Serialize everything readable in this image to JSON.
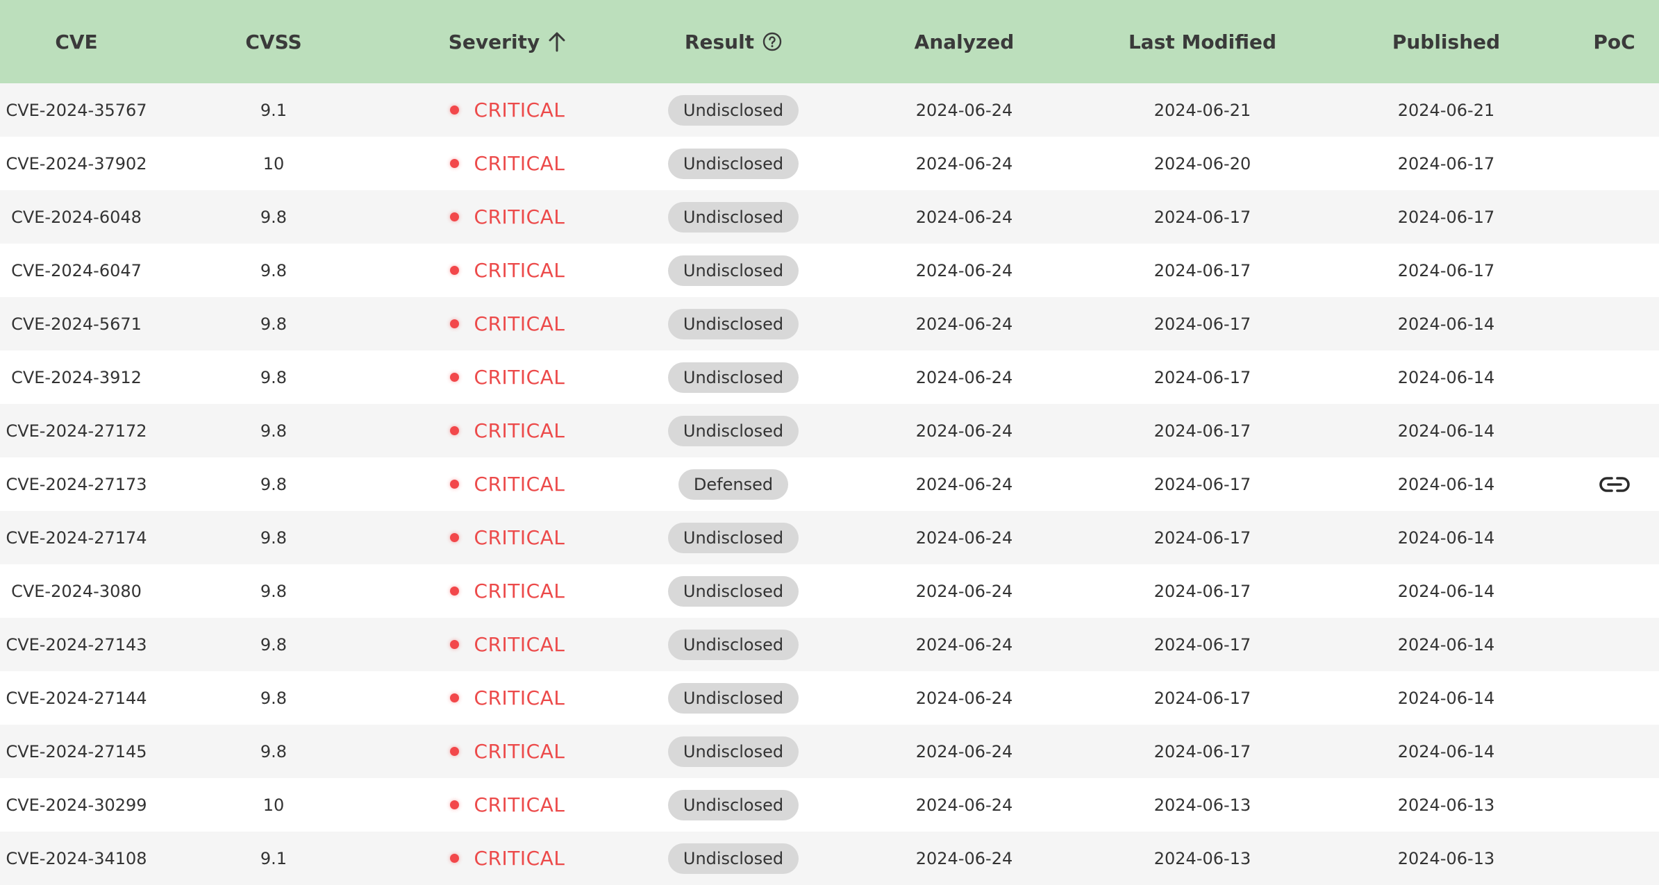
{
  "header": {
    "cve": "CVE",
    "cvss": "CVSS",
    "severity": "Severity",
    "result": "Result",
    "analyzed": "Analyzed",
    "last_modified": "Last Modified",
    "published": "Published",
    "poc": "PoC"
  },
  "colors": {
    "header_bg": "#bcdfbc",
    "critical": "#ec4a4a",
    "row_alt": "#f5f5f5",
    "pill_bg": "#d8d8d8"
  },
  "icons": {
    "sort": "arrow-up-icon",
    "help": "question-circle-icon",
    "poc": "link-icon"
  },
  "rows": [
    {
      "cve": "CVE-2024-35767",
      "cvss": "9.1",
      "severity": "CRITICAL",
      "result": "Undisclosed",
      "analyzed": "2024-06-24",
      "last_modified": "2024-06-21",
      "published": "2024-06-21",
      "poc": false
    },
    {
      "cve": "CVE-2024-37902",
      "cvss": "10",
      "severity": "CRITICAL",
      "result": "Undisclosed",
      "analyzed": "2024-06-24",
      "last_modified": "2024-06-20",
      "published": "2024-06-17",
      "poc": false
    },
    {
      "cve": "CVE-2024-6048",
      "cvss": "9.8",
      "severity": "CRITICAL",
      "result": "Undisclosed",
      "analyzed": "2024-06-24",
      "last_modified": "2024-06-17",
      "published": "2024-06-17",
      "poc": false
    },
    {
      "cve": "CVE-2024-6047",
      "cvss": "9.8",
      "severity": "CRITICAL",
      "result": "Undisclosed",
      "analyzed": "2024-06-24",
      "last_modified": "2024-06-17",
      "published": "2024-06-17",
      "poc": false
    },
    {
      "cve": "CVE-2024-5671",
      "cvss": "9.8",
      "severity": "CRITICAL",
      "result": "Undisclosed",
      "analyzed": "2024-06-24",
      "last_modified": "2024-06-17",
      "published": "2024-06-14",
      "poc": false
    },
    {
      "cve": "CVE-2024-3912",
      "cvss": "9.8",
      "severity": "CRITICAL",
      "result": "Undisclosed",
      "analyzed": "2024-06-24",
      "last_modified": "2024-06-17",
      "published": "2024-06-14",
      "poc": false
    },
    {
      "cve": "CVE-2024-27172",
      "cvss": "9.8",
      "severity": "CRITICAL",
      "result": "Undisclosed",
      "analyzed": "2024-06-24",
      "last_modified": "2024-06-17",
      "published": "2024-06-14",
      "poc": false
    },
    {
      "cve": "CVE-2024-27173",
      "cvss": "9.8",
      "severity": "CRITICAL",
      "result": "Defensed",
      "analyzed": "2024-06-24",
      "last_modified": "2024-06-17",
      "published": "2024-06-14",
      "poc": true
    },
    {
      "cve": "CVE-2024-27174",
      "cvss": "9.8",
      "severity": "CRITICAL",
      "result": "Undisclosed",
      "analyzed": "2024-06-24",
      "last_modified": "2024-06-17",
      "published": "2024-06-14",
      "poc": false
    },
    {
      "cve": "CVE-2024-3080",
      "cvss": "9.8",
      "severity": "CRITICAL",
      "result": "Undisclosed",
      "analyzed": "2024-06-24",
      "last_modified": "2024-06-17",
      "published": "2024-06-14",
      "poc": false
    },
    {
      "cve": "CVE-2024-27143",
      "cvss": "9.8",
      "severity": "CRITICAL",
      "result": "Undisclosed",
      "analyzed": "2024-06-24",
      "last_modified": "2024-06-17",
      "published": "2024-06-14",
      "poc": false
    },
    {
      "cve": "CVE-2024-27144",
      "cvss": "9.8",
      "severity": "CRITICAL",
      "result": "Undisclosed",
      "analyzed": "2024-06-24",
      "last_modified": "2024-06-17",
      "published": "2024-06-14",
      "poc": false
    },
    {
      "cve": "CVE-2024-27145",
      "cvss": "9.8",
      "severity": "CRITICAL",
      "result": "Undisclosed",
      "analyzed": "2024-06-24",
      "last_modified": "2024-06-17",
      "published": "2024-06-14",
      "poc": false
    },
    {
      "cve": "CVE-2024-30299",
      "cvss": "10",
      "severity": "CRITICAL",
      "result": "Undisclosed",
      "analyzed": "2024-06-24",
      "last_modified": "2024-06-13",
      "published": "2024-06-13",
      "poc": false
    },
    {
      "cve": "CVE-2024-34108",
      "cvss": "9.1",
      "severity": "CRITICAL",
      "result": "Undisclosed",
      "analyzed": "2024-06-24",
      "last_modified": "2024-06-13",
      "published": "2024-06-13",
      "poc": false
    }
  ]
}
